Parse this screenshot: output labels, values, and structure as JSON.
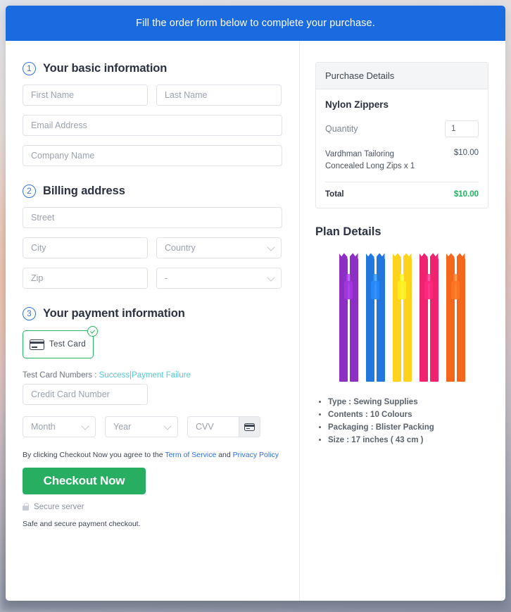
{
  "banner": {
    "text": "Fill the order form below to complete your purchase."
  },
  "sections": {
    "basic": {
      "number": "1",
      "title": "Your basic information"
    },
    "billing": {
      "number": "2",
      "title": "Billing address"
    },
    "payment": {
      "number": "3",
      "title": "Your payment information"
    }
  },
  "fields": {
    "first_name": "First Name",
    "last_name": "Last Name",
    "email": "Email Address",
    "company": "Company Name",
    "street": "Street",
    "city": "City",
    "country": "Country",
    "zip": "Zip",
    "state": "-",
    "credit_card": "Credit Card Number",
    "month": "Month",
    "year": "Year",
    "cvv": "CVV"
  },
  "payment": {
    "card_option_label": "Test  Card",
    "test_numbers_label": "Test Card Numbers :",
    "success_link": "Success",
    "separator": "|",
    "failure_link": "Payment Failure"
  },
  "terms": {
    "prefix": "By clicking Checkout Now you agree to the",
    "tos": "Term of Service",
    "and": "and",
    "privacy": "Privacy Policy"
  },
  "checkout": {
    "button_label": "Checkout Now",
    "secure_label": "Secure server",
    "safe_note": "Safe and secure payment checkout."
  },
  "purchase": {
    "header": "Purchase Details",
    "product_name": "Nylon Zippers",
    "quantity_label": "Quantity",
    "quantity_value": "1",
    "line_item_desc": "Vardhman Tailoring Concealed Long Zips x 1",
    "line_item_amount": "$10.00",
    "total_label": "Total",
    "total_amount": "$10.00"
  },
  "plan": {
    "title": "Plan Details",
    "bullets": [
      "Type : Sewing Supplies",
      "Contents : 10 Colours",
      "Packaging : Blister Packing",
      "Size : 17 inches ( 43 cm )"
    ],
    "zipper_colors": [
      "#8e2fc4",
      "#2277dd",
      "#ffd21c",
      "#f0246e",
      "#f4661c"
    ]
  },
  "colors": {
    "banner_blue": "#1a6ae0",
    "accent_blue": "#2f6fe4",
    "success_green": "#27ae60",
    "card_border_green": "#25b862",
    "link_cyan": "#4ec8d6"
  }
}
